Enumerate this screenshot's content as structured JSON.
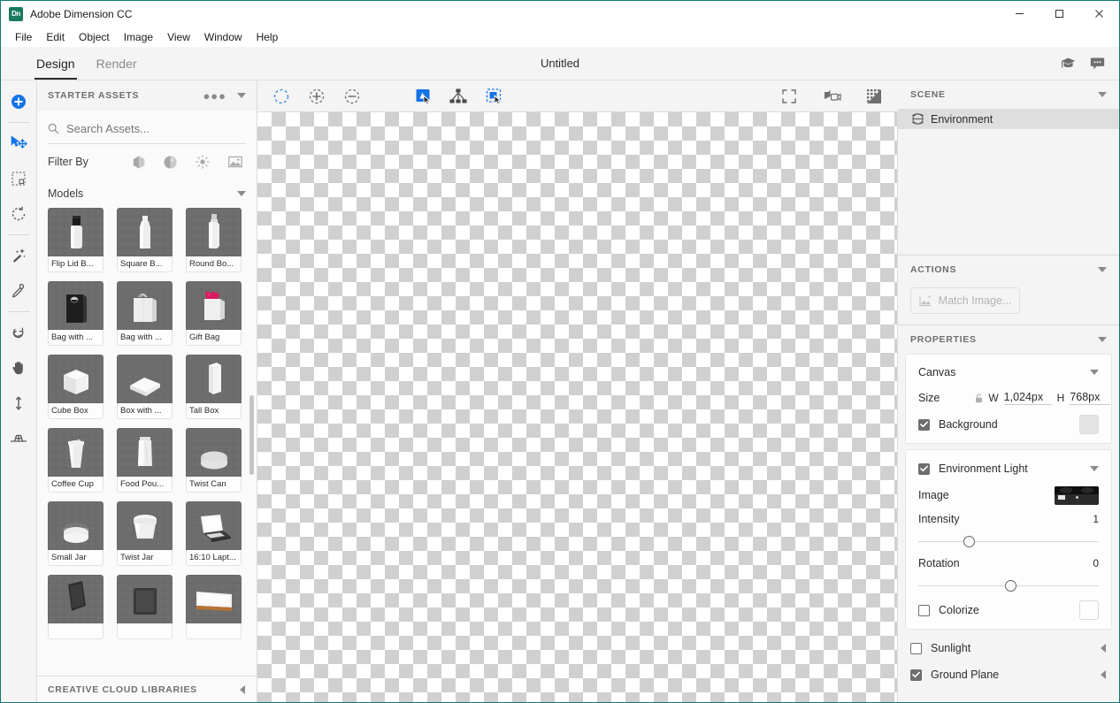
{
  "window": {
    "app_logo_text": "Dn",
    "title": "Adobe Dimension CC",
    "minimize_label": "Minimize",
    "maximize_label": "Maximize",
    "close_label": "Close"
  },
  "menubar": {
    "items": [
      {
        "label": "File"
      },
      {
        "label": "Edit"
      },
      {
        "label": "Object"
      },
      {
        "label": "Image"
      },
      {
        "label": "View"
      },
      {
        "label": "Window"
      },
      {
        "label": "Help"
      }
    ]
  },
  "tabbar": {
    "tabs": [
      {
        "label": "Design",
        "active": true
      },
      {
        "label": "Render",
        "active": false
      }
    ],
    "document_title": "Untitled",
    "right_icons": [
      {
        "name": "learn-icon"
      },
      {
        "name": "feedback-icon"
      }
    ]
  },
  "toolbar": {
    "tools": [
      {
        "name": "add-object-tool",
        "active": true
      },
      {
        "name": "select-move-tool",
        "active": true
      },
      {
        "name": "scale-tool",
        "active": false
      },
      {
        "name": "rotate-tool",
        "active": false
      },
      {
        "name": "magic-wand-tool",
        "active": false
      },
      {
        "name": "eyedropper-tool",
        "active": false
      },
      {
        "name": "orbit-tool",
        "active": false
      },
      {
        "name": "hand-tool",
        "active": false
      },
      {
        "name": "dolly-tool",
        "active": false
      },
      {
        "name": "horizon-tool",
        "active": false
      }
    ]
  },
  "assets": {
    "panel_title": "STARTER ASSETS",
    "search": {
      "placeholder": "Search Assets...",
      "value": ""
    },
    "filter_label": "Filter By",
    "filter_icons": [
      {
        "name": "models-filter-icon"
      },
      {
        "name": "materials-filter-icon"
      },
      {
        "name": "lights-filter-icon"
      },
      {
        "name": "images-filter-icon"
      }
    ],
    "group_label": "Models",
    "models": [
      {
        "label": "Flip Lid B...",
        "shape": "flip-lid-bottle"
      },
      {
        "label": "Square B...",
        "shape": "square-bottle"
      },
      {
        "label": "Round Bo...",
        "shape": "round-bottle"
      },
      {
        "label": "Bag with ...",
        "shape": "dark-bag"
      },
      {
        "label": "Bag with ...",
        "shape": "light-bag"
      },
      {
        "label": "Gift Bag",
        "shape": "gift-bag"
      },
      {
        "label": "Cube Box",
        "shape": "cube-box"
      },
      {
        "label": "Box with ...",
        "shape": "flat-box"
      },
      {
        "label": "Tall Box",
        "shape": "tall-box"
      },
      {
        "label": "Coffee Cup",
        "shape": "coffee-cup"
      },
      {
        "label": "Food Pou...",
        "shape": "food-pouch"
      },
      {
        "label": "Twist Can",
        "shape": "twist-can"
      },
      {
        "label": "Small Jar",
        "shape": "small-jar"
      },
      {
        "label": "Twist Jar",
        "shape": "twist-jar"
      },
      {
        "label": "16:10 Lapt...",
        "shape": "laptop"
      },
      {
        "label": "",
        "shape": "phone"
      },
      {
        "label": "",
        "shape": "tablet"
      },
      {
        "label": "",
        "shape": "frame"
      }
    ],
    "libraries_title": "CREATIVE CLOUD LIBRARIES"
  },
  "canvas_toolbar": {
    "left_tools": [
      {
        "name": "selection-marquee-icon",
        "accent": true
      },
      {
        "name": "add-to-selection-icon",
        "accent": false
      },
      {
        "name": "subtract-from-selection-icon",
        "accent": false
      },
      {
        "name": "select-object-icon",
        "accent": true
      },
      {
        "name": "select-group-icon",
        "accent": false
      },
      {
        "name": "select-similar-icon",
        "accent": true
      }
    ],
    "right_tools": [
      {
        "name": "fit-to-screen-icon"
      },
      {
        "name": "camera-bookmarks-icon"
      },
      {
        "name": "render-preview-icon"
      }
    ]
  },
  "scene": {
    "title": "SCENE",
    "items": [
      {
        "label": "Environment",
        "icon": "globe-icon",
        "selected": true
      }
    ]
  },
  "actions": {
    "title": "ACTIONS",
    "match_image_label": "Match Image...",
    "match_image_enabled": false
  },
  "properties": {
    "title": "PROPERTIES",
    "canvas": {
      "label": "Canvas",
      "size_label": "Size",
      "width_label": "W",
      "width_value": "1,024px",
      "height_label": "H",
      "height_value": "768px",
      "background": {
        "label": "Background",
        "checked": true,
        "color": "#e4e4e4"
      }
    },
    "environment_light": {
      "label": "Environment Light",
      "checked": true,
      "image_label": "Image",
      "intensity_label": "Intensity",
      "intensity_value": "1",
      "intensity_percent": 25,
      "rotation_label": "Rotation",
      "rotation_value": "0",
      "rotation_percent": 48,
      "colorize": {
        "label": "Colorize",
        "checked": false,
        "color": "#fdfdfd"
      }
    },
    "sunlight": {
      "label": "Sunlight",
      "checked": false
    },
    "ground_plane": {
      "label": "Ground Plane",
      "checked": true
    }
  },
  "colors": {
    "accent_blue": "#1473e6",
    "window_border": "#0f7b73",
    "panel_bg": "#f4f4f4",
    "selection_gray": "#dedede"
  }
}
